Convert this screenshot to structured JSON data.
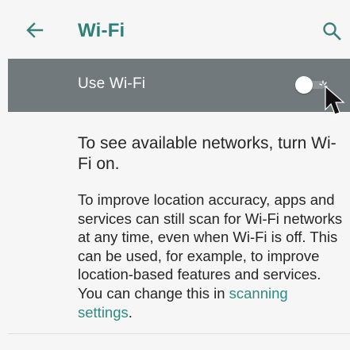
{
  "appbar": {
    "title": "Wi-Fi",
    "back_icon": "arrow-left-icon",
    "search_icon": "search-icon",
    "accent_color": "#2f7f79"
  },
  "wifi_toggle": {
    "label": "Use Wi-Fi",
    "state": "off",
    "row_color": "#72797d"
  },
  "message": {
    "headline": "To see available networks, turn Wi-Fi on.",
    "body": "To improve location accuracy, apps and services can still scan for Wi-Fi networks at any time, even when Wi-Fi is off. This can be used, for example, to improve location-based features and services. You can change this in ",
    "link_text": "scanning settings",
    "trailing": ".",
    "link_color": "#2f8a82"
  }
}
